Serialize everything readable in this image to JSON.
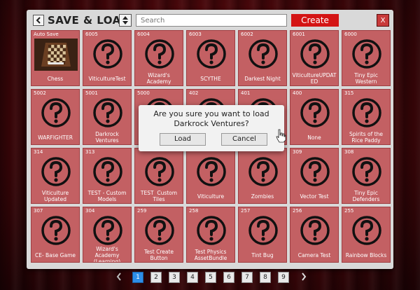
{
  "header": {
    "title": "SAVE & LOAD",
    "search_placeholder": "Search",
    "create_label": "Create",
    "close_label": "X",
    "back_icon": "chevron-left-icon",
    "sort_icon": "sort-icon"
  },
  "tiles": [
    {
      "id": "Auto Save",
      "name": "Chess",
      "thumb": "chess"
    },
    {
      "id": "6005",
      "name": "ViticultureTest"
    },
    {
      "id": "6004",
      "name": "Wizard's Academy"
    },
    {
      "id": "6003",
      "name": "SCYTHE"
    },
    {
      "id": "6002",
      "name": "Darkest Night"
    },
    {
      "id": "6001",
      "name": "ViticultureUPDAT ED"
    },
    {
      "id": "6000",
      "name": "Tiny Epic Western"
    },
    {
      "id": "5002",
      "name": "WARFIGHTER"
    },
    {
      "id": "5001",
      "name": "Darkrock Ventures"
    },
    {
      "id": "5000",
      "name": ""
    },
    {
      "id": "402",
      "name": ""
    },
    {
      "id": "401",
      "name": ""
    },
    {
      "id": "400",
      "name": "None"
    },
    {
      "id": "315",
      "name": "Spirits of the Rice Paddy"
    },
    {
      "id": "314",
      "name": "Viticulture Updated"
    },
    {
      "id": "313",
      "name": "TEST - Custom Models"
    },
    {
      "id": "",
      "name": "TEST  Custom Tiles"
    },
    {
      "id": "",
      "name": "Viticulture"
    },
    {
      "id": "",
      "name": "Zombies"
    },
    {
      "id": "309",
      "name": "Vector Test"
    },
    {
      "id": "308",
      "name": "Tiny Epic Defenders"
    },
    {
      "id": "307",
      "name": "CE- Base Game"
    },
    {
      "id": "304",
      "name": "Wizard's Academy (Learning)"
    },
    {
      "id": "259",
      "name": "Test Create Button"
    },
    {
      "id": "258",
      "name": "Test Physics AssetBundle"
    },
    {
      "id": "257",
      "name": "Tint Bug"
    },
    {
      "id": "256",
      "name": "Camera Test"
    },
    {
      "id": "255",
      "name": "Rainbow Blocks"
    }
  ],
  "dialog": {
    "message": "Are you sure you want to load\nDarkrock Ventures?",
    "load_label": "Load",
    "cancel_label": "Cancel"
  },
  "pagination": {
    "pages": [
      "1",
      "2",
      "3",
      "4",
      "5",
      "6",
      "7",
      "8",
      "9"
    ],
    "current": "1",
    "prev_icon": "chevron-left-icon",
    "next_icon": "chevron-right-icon"
  },
  "colors": {
    "tile": "#c36063",
    "create": "#d41414",
    "active_page": "#2d8ee8"
  }
}
